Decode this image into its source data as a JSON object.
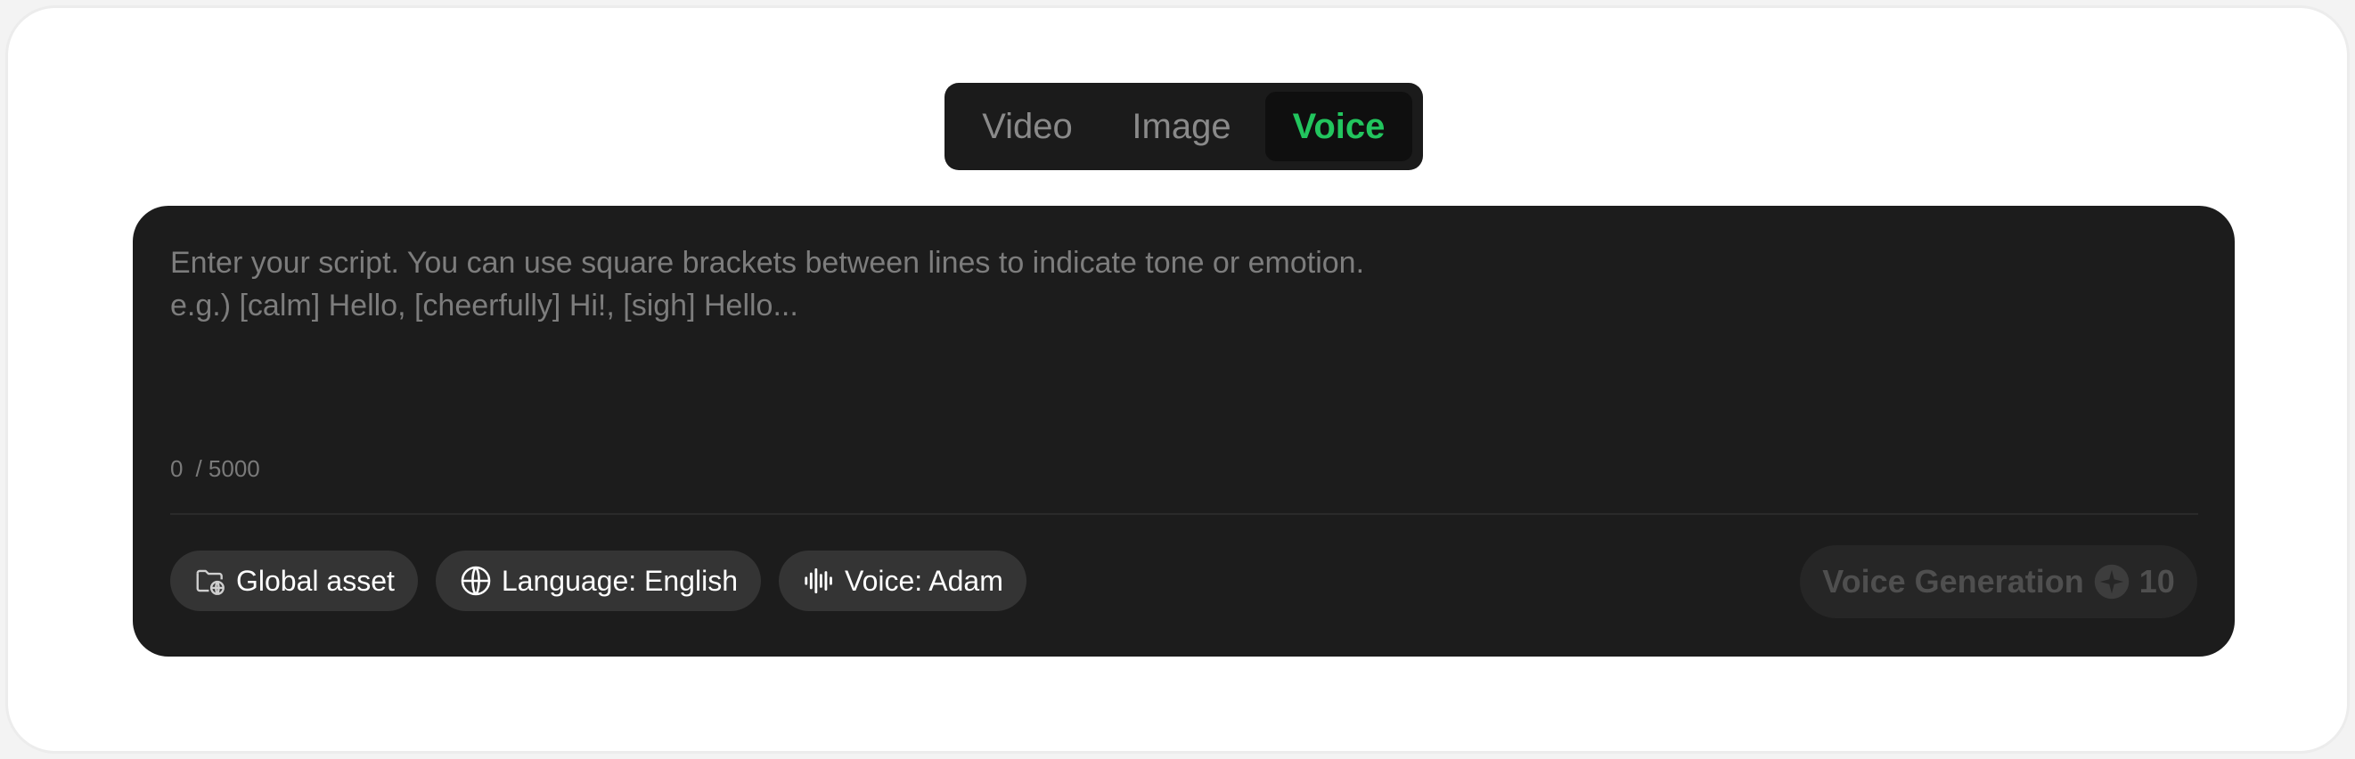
{
  "tabs": {
    "video": "Video",
    "image": "Image",
    "voice": "Voice",
    "active": "Voice"
  },
  "editor": {
    "placeholder": "Enter your script. You can use square brackets between lines to indicate tone or emotion.\ne.g.) [calm] Hello, [cheerfully] Hi!, [sigh] Hello...",
    "value": "",
    "char_count": "0",
    "char_limit": "/ 5000"
  },
  "chips": {
    "global_asset": "Global asset",
    "language": "Language: English",
    "voice": "Voice: Adam"
  },
  "generate": {
    "label": "Voice Generation",
    "credits": "10"
  },
  "colors": {
    "accent": "#22c55e",
    "panel": "#1c1c1c",
    "chip": "#343434"
  },
  "icons": {
    "global_asset": "folder-globe-icon",
    "language": "globe-icon",
    "voice": "waveform-icon",
    "credits": "sparkle-icon"
  }
}
